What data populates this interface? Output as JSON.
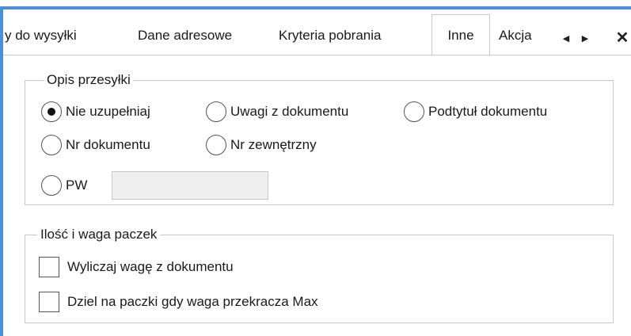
{
  "tabs": [
    {
      "label": "y do wysyłki"
    },
    {
      "label": "Dane adresowe"
    },
    {
      "label": "Kryteria pobrania"
    },
    {
      "label": "Inne"
    },
    {
      "label": "Akcja"
    }
  ],
  "active_tab": "Inne",
  "nav": {
    "left_glyph": "◀",
    "right_glyph": "▶",
    "close_glyph": "✕"
  },
  "opis": {
    "title": "Opis przesyłki",
    "options": [
      {
        "label": "Nie uzupełniaj",
        "checked": true
      },
      {
        "label": "Uwagi z dokumentu",
        "checked": false
      },
      {
        "label": "Podtytuł dokumentu",
        "checked": false
      },
      {
        "label": "Nr dokumentu",
        "checked": false
      },
      {
        "label": "Nr zewnętrzny",
        "checked": false
      },
      {
        "label": "PW",
        "checked": false
      }
    ],
    "pw_value": ""
  },
  "paczki": {
    "title": "Ilość i waga paczek",
    "checkboxes": [
      {
        "label": "Wyliczaj wagę z dokumentu",
        "checked": false
      },
      {
        "label": "Dziel na paczki gdy waga przekracza Max",
        "checked": false
      }
    ]
  },
  "colors": {
    "accent": "#4a8fd8",
    "border": "#c8c8c8",
    "disabled_input": "#efefef"
  }
}
